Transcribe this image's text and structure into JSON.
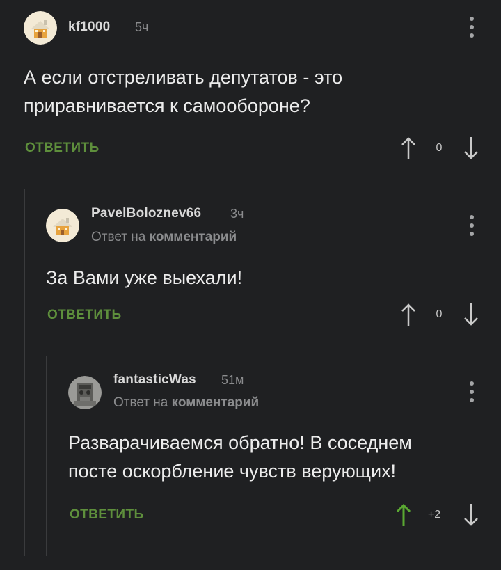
{
  "comments": [
    {
      "username": "kf1000",
      "time": "5ч",
      "text_lines": [
        "А если отстреливать депутатов - это",
        "приравнивается к самообороне?"
      ],
      "reply_label": "ОТВЕТИТЬ",
      "rating": "0"
    },
    {
      "username": "PavelBoloznev66",
      "time": "3ч",
      "reply_to_prefix": "Ответ на",
      "reply_to_target": "комментарий",
      "text_lines": [
        "За Вами уже выехали!"
      ],
      "reply_label": "ОТВЕТИТЬ",
      "rating": "0"
    },
    {
      "username": "fantasticWas",
      "time": "51м",
      "reply_to_prefix": "Ответ на",
      "reply_to_target": "комментарий",
      "text_lines": [
        "Разварачиваемся обратно! В соседнем",
        "посте оскорбление чувств верующих!"
      ],
      "reply_label": "ОТВЕТИТЬ",
      "rating": "+2"
    }
  ],
  "colors": {
    "background": "#1f2022",
    "accent_green": "#5e8f3c",
    "upvoted_arrow": "#5aa832",
    "muted": "#8b8c8e"
  },
  "icons": {
    "more": "more-vertical-icon",
    "upvote": "arrow-up-icon",
    "downvote": "arrow-down-icon",
    "default_avatar": "house-avatar-icon"
  }
}
